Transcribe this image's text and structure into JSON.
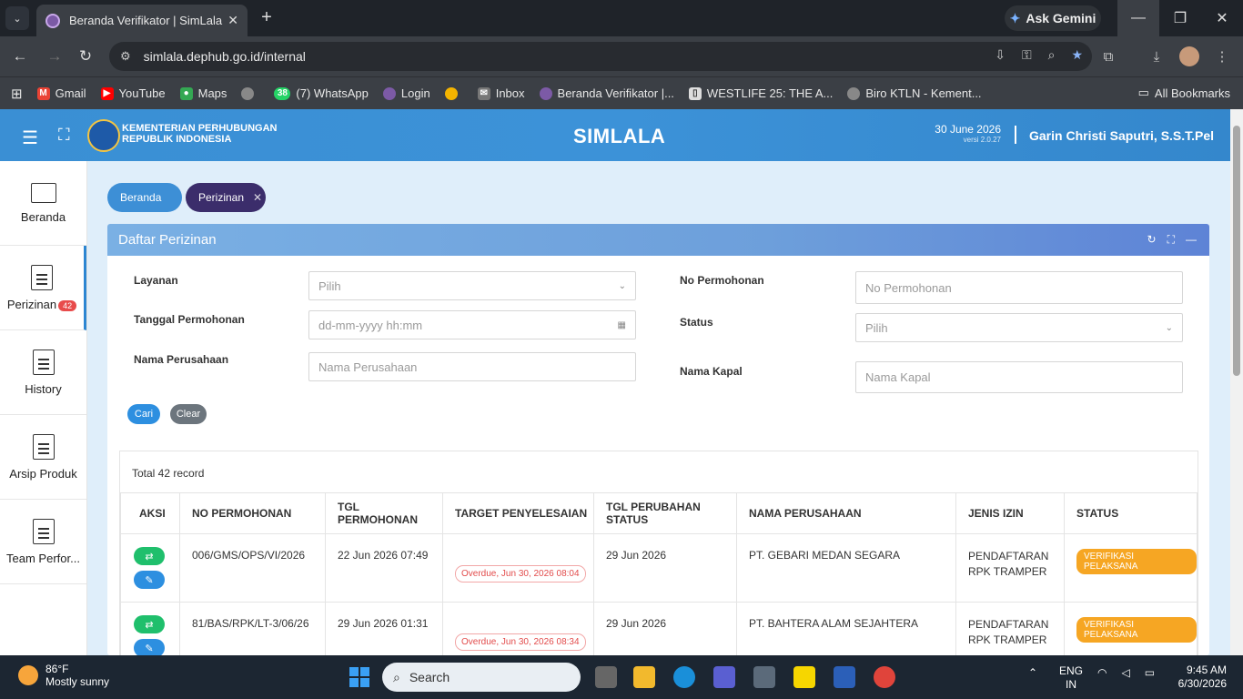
{
  "browser": {
    "tab_title": "Beranda Verifikator | SimLala",
    "url": "simlala.dephub.go.id/internal",
    "gemini_label": "Ask Gemini",
    "bookmarks": [
      {
        "label": "Gmail",
        "icon": "gmail-icon",
        "color": "#ea4335"
      },
      {
        "label": "YouTube",
        "icon": "youtube-icon",
        "color": "#ff0000"
      },
      {
        "label": "Maps",
        "icon": "maps-icon",
        "color": "#34a853"
      },
      {
        "label": "",
        "icon": "globe-icon",
        "color": "#888888"
      },
      {
        "label": "(7) WhatsApp",
        "icon": "whatsapp-icon",
        "color": "#25d366"
      },
      {
        "label": "Login",
        "icon": "simlala-icon",
        "color": "#7c5aa6"
      },
      {
        "label": "",
        "icon": "pinwheel-icon",
        "color": "#f4b400"
      },
      {
        "label": "Inbox",
        "icon": "mail-icon",
        "color": "#aaaaaa"
      },
      {
        "label": "Beranda Verifikator |...",
        "icon": "simlala-icon",
        "color": "#7c5aa6"
      },
      {
        "label": "WESTLIFE 25: THE A...",
        "icon": "page-icon",
        "color": "#dddddd"
      },
      {
        "label": "Biro KTLN - Kement...",
        "icon": "globe-icon",
        "color": "#888888"
      }
    ],
    "all_bookmarks": "All Bookmarks",
    "whatsapp_count": "38"
  },
  "header": {
    "org_line1": "KEMENTERIAN PERHUBUNGAN",
    "org_line2": "REPUBLIK INDONESIA",
    "app_name": "SIMLALA",
    "date": "30 June 2026",
    "version": "versi 2.0.27",
    "user": "Garin Christi Saputri, S.S.T.Pel"
  },
  "sidebar": {
    "items": [
      {
        "label": "Beranda"
      },
      {
        "label": "Perizinan",
        "badge": "42"
      },
      {
        "label": "History"
      },
      {
        "label": "Arsip Produk"
      },
      {
        "label": "Team Perfor..."
      }
    ]
  },
  "breadcrumbs": {
    "home": "Beranda",
    "current": "Perizinan"
  },
  "panel": {
    "title": "Daftar Perizinan",
    "filters": {
      "layanan_label": "Layanan",
      "layanan_value": "Pilih",
      "tanggal_label": "Tanggal Permohonan",
      "tanggal_placeholder": "dd-mm-yyyy hh:mm",
      "perusahaan_label": "Nama Perusahaan",
      "perusahaan_placeholder": "Nama Perusahaan",
      "no_label": "No Permohonan",
      "no_placeholder": "No Permohonan",
      "status_label": "Status",
      "status_value": "Pilih",
      "kapal_label": "Nama Kapal",
      "kapal_placeholder": "Nama Kapal"
    },
    "buttons": {
      "search": "Cari",
      "clear": "Clear"
    },
    "total": "Total 42 record",
    "columns": [
      "AKSI",
      "NO PERMOHONAN",
      "TGL PERMOHONAN",
      "TARGET PENYELESAIAN",
      "TGL PERUBAHAN STATUS",
      "NAMA PERUSAHAAN",
      "JENIS IZIN",
      "STATUS"
    ],
    "rows": [
      {
        "no": "006/GMS/OPS/VI/2026",
        "tgl": "22 Jun 2026 07:49",
        "target": "Overdue, Jun 30, 2026 08:04",
        "tgl_status": "29 Jun 2026",
        "perusahaan": "PT. GEBARI MEDAN SEGARA",
        "jenis1": "PENDAFTARAN",
        "jenis2": "RPK TRAMPER",
        "status": "VERIFIKASI PELAKSANA"
      },
      {
        "no": "81/BAS/RPK/LT-3/06/26",
        "tgl": "29 Jun 2026 01:31",
        "target": "Overdue, Jun 30, 2026 08:34",
        "tgl_status": "29 Jun 2026",
        "perusahaan": "PT. BAHTERA ALAM SEJAHTERA",
        "jenis1": "PENDAFTARAN",
        "jenis2": "RPK TRAMPER",
        "status": "VERIFIKASI PELAKSANA"
      }
    ]
  },
  "taskbar": {
    "temp": "86°F",
    "weather": "Mostly sunny",
    "search": "Search",
    "lang1": "ENG",
    "lang2": "IN",
    "time": "9:45 AM",
    "date": "6/30/2026"
  }
}
